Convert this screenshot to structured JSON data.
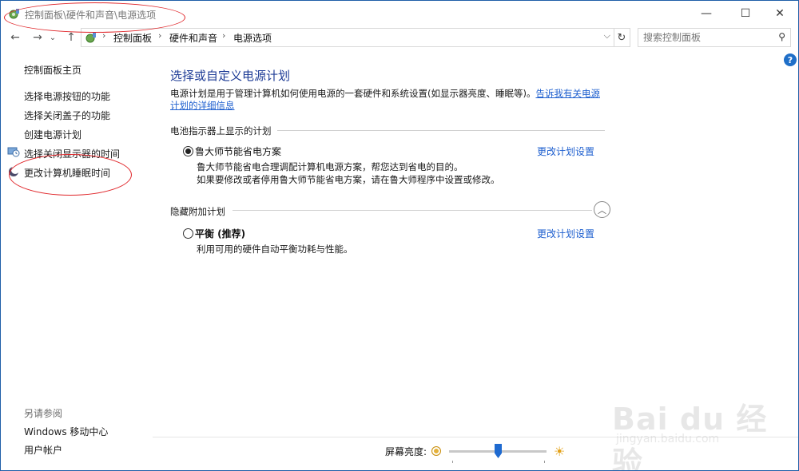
{
  "window": {
    "title": "控制面板\\硬件和声音\\电源选项",
    "controls": {
      "minimize": "—",
      "maximize": "☐",
      "close": "✕"
    }
  },
  "nav": {
    "back": "←",
    "forward": "→",
    "recent": "⌄",
    "up": "↑",
    "breadcrumbs": [
      "控制面板",
      "硬件和声音",
      "电源选项"
    ],
    "breadcrumb_separator": "›",
    "refresh": "↻",
    "search_placeholder": "搜索控制面板",
    "help": "?"
  },
  "sidebar": {
    "home": "控制面板主页",
    "items": [
      {
        "label": "选择电源按钮的功能"
      },
      {
        "label": "选择关闭盖子的功能"
      },
      {
        "label": "创建电源计划"
      },
      {
        "label": "选择关闭显示器的时间",
        "icon": "monitor-clock-icon"
      },
      {
        "label": "更改计算机睡眠时间",
        "icon": "moon-icon"
      }
    ],
    "see_also_title": "另请参阅",
    "see_also": [
      {
        "label": "Windows 移动中心"
      },
      {
        "label": "用户帐户"
      }
    ]
  },
  "main": {
    "title": "选择或自定义电源计划",
    "description": "电源计划是用于管理计算机如何使用电源的一套硬件和系统设置(如显示器亮度、睡眠等)。",
    "description_link": "告诉我有关电源计划的详细信息",
    "battery_section": "电池指示器上显示的计划",
    "plans": [
      {
        "name": "鲁大师节能省电方案",
        "selected": true,
        "desc1": "鲁大师节能省电合理调配计算机电源方案，帮您达到省电的目的。",
        "desc2": "如果要修改或者停用鲁大师节能省电方案，请在鲁大师程序中设置或修改。",
        "change_link": "更改计划设置"
      }
    ],
    "hidden_section": "隐藏附加计划",
    "hidden_plans": [
      {
        "name": "平衡 (推荐)",
        "selected": false,
        "desc1": "利用可用的硬件自动平衡功耗与性能。",
        "change_link": "更改计划设置"
      }
    ]
  },
  "footer": {
    "brightness_label": "屏幕亮度:",
    "brightness_level": 0.5
  },
  "watermark": {
    "brand": "Bai du 经验",
    "url": "jingyan.baidu.com"
  },
  "colors": {
    "accent": "#1e6ad0",
    "link": "#1e5fcf",
    "title": "#1e3c96",
    "annotation": "#e0262a",
    "border": "#1f5fa8"
  }
}
